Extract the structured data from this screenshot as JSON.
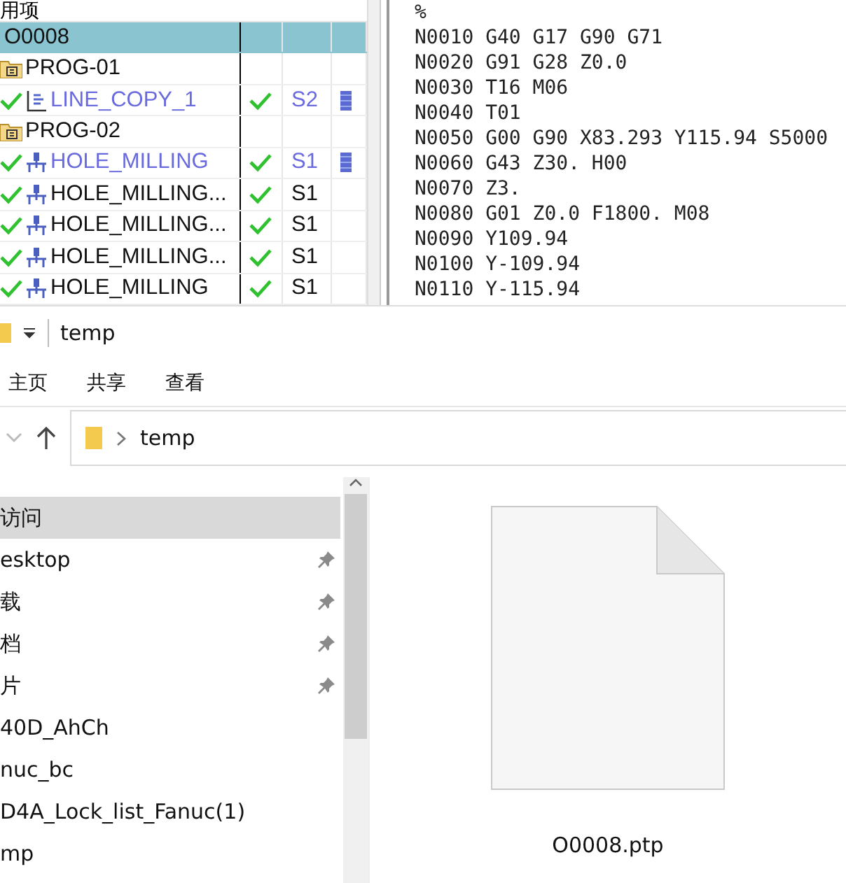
{
  "navigator": {
    "header": "用项",
    "tree": [
      {
        "kind": "program",
        "name": "O0008",
        "selected": true,
        "children": [
          {
            "kind": "group",
            "name": "PROG-01",
            "selected": false,
            "children": [
              {
                "kind": "line",
                "name": "LINE_COPY_1",
                "selected": false,
                "checked": true,
                "path": "S2",
                "active": true
              }
            ]
          },
          {
            "kind": "group",
            "name": "PROG-02",
            "selected": false,
            "children": [
              {
                "kind": "hole",
                "name": "HOLE_MILLING",
                "selected": false,
                "checked": true,
                "path": "S1",
                "active": true
              },
              {
                "kind": "hole",
                "name": "HOLE_MILLING...",
                "selected": false,
                "checked": true,
                "path": "S1",
                "active": false
              },
              {
                "kind": "hole",
                "name": "HOLE_MILLING...",
                "selected": false,
                "checked": true,
                "path": "S1",
                "active": false
              },
              {
                "kind": "hole",
                "name": "HOLE_MILLING...",
                "selected": false,
                "checked": true,
                "path": "S1",
                "active": false
              },
              {
                "kind": "hole",
                "name": "HOLE_MILLING",
                "selected": false,
                "checked": true,
                "path": "S1",
                "active": false
              }
            ]
          }
        ]
      }
    ]
  },
  "code": {
    "lines": [
      "%",
      "N0010 G40 G17 G90 G71",
      "N0020 G91 G28 Z0.0",
      "N0030 T16 M06",
      "N0040 T01",
      "N0050 G00 G90 X83.293 Y115.94 S5000",
      "N0060 G43 Z30. H00",
      "N0070 Z3.",
      "N0080 G01 Z0.0 F1800. M08",
      "N0090 Y109.94",
      "N0100 Y-109.94",
      "N0110 Y-115.94"
    ]
  },
  "explorer": {
    "title": "temp",
    "ribbon_tabs": [
      "主页",
      "共享",
      "查看"
    ],
    "address": "temp",
    "nav_items": [
      {
        "label": "访问",
        "selected": true,
        "pinned": false
      },
      {
        "label": "esktop",
        "selected": false,
        "pinned": true
      },
      {
        "label": "载",
        "selected": false,
        "pinned": true
      },
      {
        "label": "档",
        "selected": false,
        "pinned": true
      },
      {
        "label": "片",
        "selected": false,
        "pinned": true
      },
      {
        "label": "40D_AhCh",
        "selected": false,
        "pinned": false
      },
      {
        "label": "nuc_bc",
        "selected": false,
        "pinned": false
      },
      {
        "label": "D4A_Lock_list_Fanuc(1)",
        "selected": false,
        "pinned": false
      },
      {
        "label": "mp",
        "selected": false,
        "pinned": false
      }
    ],
    "files": [
      {
        "name": "O0008.ptp"
      }
    ]
  }
}
